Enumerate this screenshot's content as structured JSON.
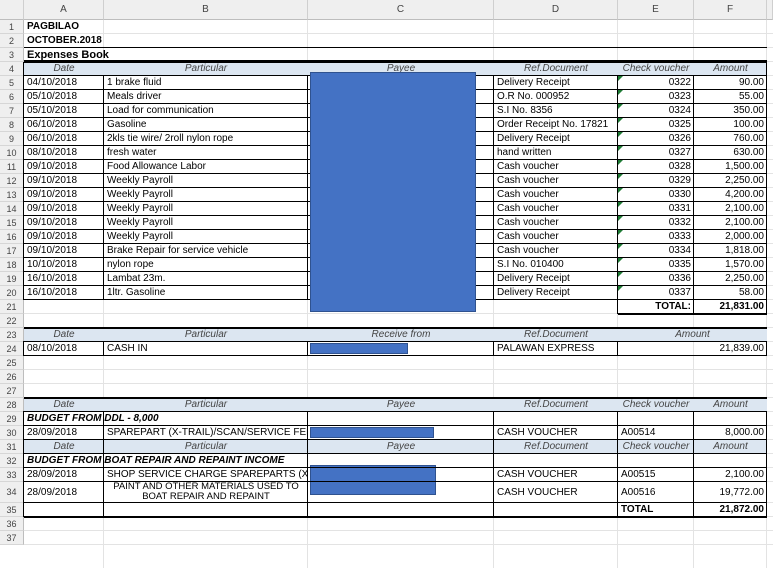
{
  "columns": [
    "A",
    "B",
    "C",
    "D",
    "E",
    "F"
  ],
  "rows": [
    "1",
    "2",
    "3",
    "4",
    "5",
    "6",
    "7",
    "8",
    "9",
    "10",
    "11",
    "12",
    "13",
    "14",
    "15",
    "16",
    "17",
    "18",
    "19",
    "20",
    "21",
    "22",
    "23",
    "24",
    "25",
    "26",
    "27",
    "28",
    "29",
    "30",
    "31",
    "32",
    "33",
    "34",
    "35",
    "36",
    "37"
  ],
  "title": {
    "company": "PAGBILAO",
    "period": "OCTOBER.2018",
    "book": "Expenses Book"
  },
  "expenses_header": {
    "date": "Date",
    "particular": "Particular",
    "payee": "Payee",
    "ref": "Ref.Document",
    "check": "Check voucher",
    "amount": "Amount"
  },
  "expenses": [
    {
      "date": "04/10/2018",
      "particular": "1 brake fluid",
      "ref": "Delivery Receipt",
      "check": "0322",
      "amount": "90.00"
    },
    {
      "date": "05/10/2018",
      "particular": "Meals driver",
      "ref": "O.R No. 000952",
      "check": "0323",
      "amount": "55.00"
    },
    {
      "date": "05/10/2018",
      "particular": "Load for communication",
      "ref": "S.I No. 8356",
      "check": "0324",
      "amount": "350.00"
    },
    {
      "date": "06/10/2018",
      "particular": "Gasoline",
      "ref": "Order Receipt No. 17821",
      "check": "0325",
      "amount": "100.00"
    },
    {
      "date": "06/10/2018",
      "particular": "2kls tie wire/ 2roll nylon rope",
      "ref": "Delivery Receipt",
      "check": "0326",
      "amount": "760.00"
    },
    {
      "date": "08/10/2018",
      "particular": "fresh water",
      "ref": "hand written",
      "check": "0327",
      "amount": "630.00"
    },
    {
      "date": "09/10/2018",
      "particular": "Food Allowance Labor",
      "ref": "Cash voucher",
      "check": "0328",
      "amount": "1,500.00"
    },
    {
      "date": "09/10/2018",
      "particular": "Weekly Payroll",
      "ref": "Cash voucher",
      "check": "0329",
      "amount": "2,250.00"
    },
    {
      "date": "09/10/2018",
      "particular": "Weekly Payroll",
      "ref": "Cash voucher",
      "check": "0330",
      "amount": "4,200.00"
    },
    {
      "date": "09/10/2018",
      "particular": "Weekly Payroll",
      "ref": "Cash voucher",
      "check": "0331",
      "amount": "2,100.00"
    },
    {
      "date": "09/10/2018",
      "particular": "Weekly Payroll",
      "ref": "Cash voucher",
      "check": "0332",
      "amount": "2,100.00"
    },
    {
      "date": "09/10/2018",
      "particular": "Weekly Payroll",
      "ref": "Cash voucher",
      "check": "0333",
      "amount": "2,000.00"
    },
    {
      "date": "09/10/2018",
      "particular": "Brake Repair for service vehicle",
      "ref": "Cash voucher",
      "check": "0334",
      "amount": "1,818.00"
    },
    {
      "date": "10/10/2018",
      "particular": "nylon rope",
      "ref": "S.I No. 010400",
      "check": "0335",
      "amount": "1,570.00"
    },
    {
      "date": "16/10/2018",
      "particular": "Lambat 23m.",
      "ref": "Delivery Receipt",
      "check": "0336",
      "amount": "2,250.00"
    },
    {
      "date": "16/10/2018",
      "particular": "1ltr. Gasoline",
      "ref": "Delivery Receipt",
      "check": "0337",
      "amount": "58.00"
    }
  ],
  "expenses_total": {
    "label": "TOTAL:",
    "amount": "21,831.00"
  },
  "cashin_header": {
    "date": "Date",
    "particular": "Particular",
    "receive": "Receive from",
    "ref": "Ref.Document",
    "amount": "Amount"
  },
  "cashin": {
    "date": "08/10/2018",
    "particular": "CASH IN",
    "ref": "PALAWAN EXPRESS",
    "amount": "21,839.00"
  },
  "budget_header": {
    "date": "Date",
    "particular": "Particular",
    "payee": "Payee",
    "ref": "Ref.Document",
    "check": "Check voucher",
    "amount": "Amount"
  },
  "budget_ddl": {
    "label": "BUDGET FROM DDL - 8,000",
    "date": "28/09/2018",
    "particular": "SPAREPART (X-TRAIL)/SCAN/SERVICE FEE",
    "ref": "CASH VOUCHER",
    "check": "A00514",
    "amount": "8,000.00"
  },
  "budget_boat": {
    "label": "BUDGET FROM BOAT REPAIR AND REPAINT INCOME",
    "items": [
      {
        "date": "28/09/2018",
        "particular": "SHOP SERVICE CHARGE SPAREPARTS (X-TRAIL)",
        "ref": "CASH VOUCHER",
        "check": "A00515",
        "amount": "2,100.00"
      },
      {
        "date": "28/09/2018",
        "particular_line1": "PAINT AND OTHER MATERIALS  USED TO",
        "particular_line2": "BOAT REPAIR AND REPAINT",
        "ref": "CASH VOUCHER",
        "check": "A00516",
        "amount": "19,772.00"
      }
    ],
    "total": {
      "label": "TOTAL",
      "amount": "21,872.00"
    }
  },
  "colors": {
    "header_fill": "#dce6f1",
    "redaction": "#4472c4",
    "grid": "#e3e3e3"
  }
}
